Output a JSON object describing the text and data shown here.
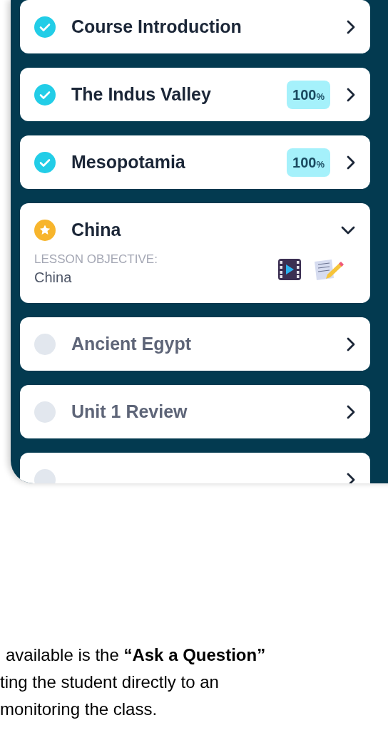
{
  "lessons": [
    {
      "title": "Course Introduction",
      "kind": "complete",
      "expanded": false
    },
    {
      "title": "The Indus Valley",
      "kind": "complete",
      "expanded": false,
      "badge": {
        "value": "100",
        "unit": "%"
      }
    },
    {
      "title": "Mesopotamia",
      "kind": "complete",
      "expanded": false,
      "badge": {
        "value": "100",
        "unit": "%"
      }
    },
    {
      "title": "China",
      "kind": "current",
      "expanded": true,
      "objective_label": "LESSON OBJECTIVE:",
      "objective": "China"
    },
    {
      "title": "Ancient Egypt",
      "kind": "locked",
      "expanded": false
    },
    {
      "title": "Unit 1 Review",
      "kind": "locked",
      "expanded": false
    },
    {
      "kind": "locked",
      "expanded": false
    }
  ],
  "caption_lines": [
    "available is the **“Ask a Question”**",
    "ting the student directly to an",
    "monitoring the class."
  ]
}
